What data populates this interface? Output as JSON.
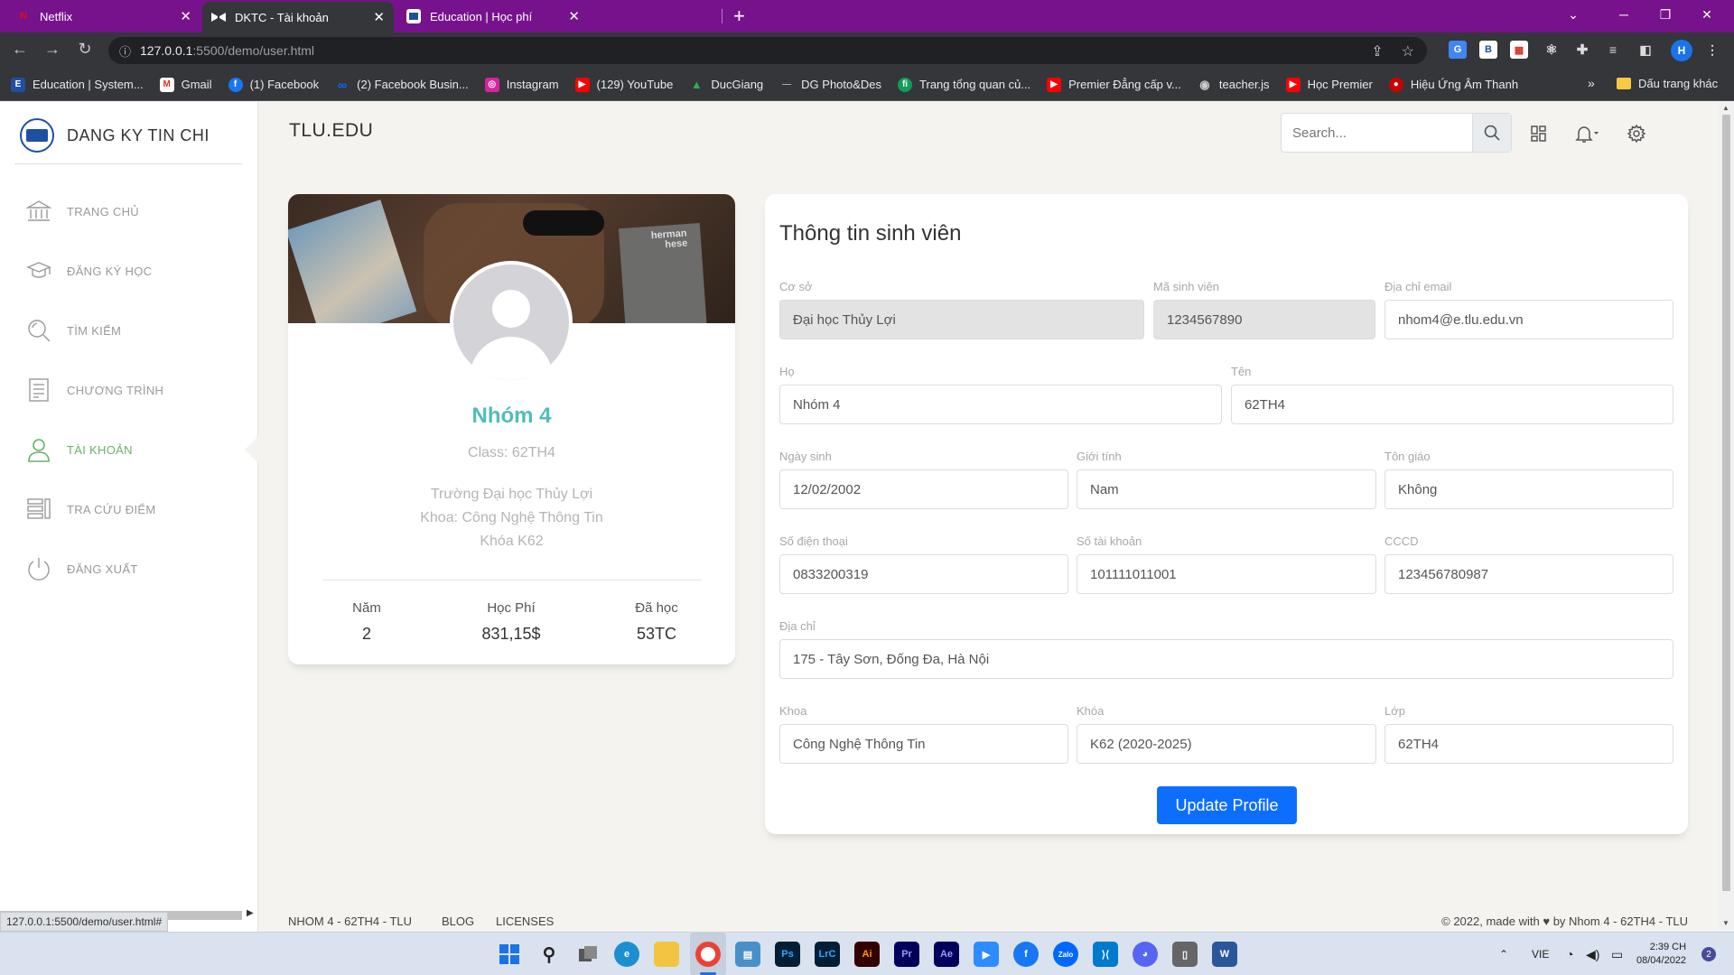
{
  "browser": {
    "tabs": [
      {
        "title": "Netflix",
        "icon": "netflix-icon",
        "color": "#e50914"
      },
      {
        "title": "DKTC - Tài khoản",
        "icon": "bow-tie-icon",
        "color": "#ffffff"
      },
      {
        "title": "Education | Học phí",
        "icon": "education-favicon",
        "color": "#1f4fa0"
      }
    ],
    "url_host": "127.0.0.1",
    "url_path": ":5500/demo/user.html",
    "profile_initial": "H",
    "bookmarks": [
      {
        "label": "Education | System...",
        "color": "#1f4fa0"
      },
      {
        "label": "Gmail",
        "color": "#d93025"
      },
      {
        "label": "(1) Facebook",
        "color": "#1877f2"
      },
      {
        "label": "(2) Facebook Busin...",
        "color": "#0866ff"
      },
      {
        "label": "Instagram",
        "color": "#d6249f"
      },
      {
        "label": "(129) YouTube",
        "color": "#ff0000"
      },
      {
        "label": "DucGiang",
        "color": "#34a853"
      },
      {
        "label": "DG Photo&Des",
        "color": "#555555"
      },
      {
        "label": "Trang tổng quan củ...",
        "color": "#0f9d58"
      },
      {
        "label": "Premier Đẳng cấp v...",
        "color": "#ff0000"
      },
      {
        "label": "teacher.js",
        "color": "#777777"
      },
      {
        "label": "Học Premier",
        "color": "#ff0000"
      },
      {
        "label": "Hiệu Ứng Âm Thanh",
        "color": "#cc0000"
      }
    ],
    "bookmarks_more": "»",
    "other_bookmarks": "Dấu trang khác",
    "status_url": "127.0.0.1:5500/demo/user.html#"
  },
  "sidebar": {
    "brand": "DANG KY TIN CHI",
    "items": [
      {
        "label": "TRANG CHỦ",
        "icon": "bank-icon",
        "active": false
      },
      {
        "label": "ĐĂNG KÝ HỌC",
        "icon": "graduation-cap-icon",
        "active": false
      },
      {
        "label": "TÌM KIẾM",
        "icon": "search-icon",
        "active": false
      },
      {
        "label": "CHƯƠNG TRÌNH",
        "icon": "document-icon",
        "active": false
      },
      {
        "label": "TÀI KHOẢN",
        "icon": "user-icon",
        "active": true
      },
      {
        "label": "TRA CỨU ĐIỂM",
        "icon": "list-icon",
        "active": false
      },
      {
        "label": "ĐĂNG XUẤT",
        "icon": "power-icon",
        "active": false
      }
    ]
  },
  "topbar": {
    "title": "TLU.EDU",
    "search_placeholder": "Search..."
  },
  "profile": {
    "name": "Nhóm 4",
    "class": "Class: 62TH4",
    "desc_line1": "Trường Đại học Thủy Lợi",
    "desc_line2": "Khoa: Công Nghệ Thông Tin",
    "desc_line3": "Khóa K62",
    "cover_book_text": "herman hese",
    "stats": [
      {
        "key": "Năm",
        "value": "2"
      },
      {
        "key": "Học Phí",
        "value": "831,15$"
      },
      {
        "key": "Đã học",
        "value": "53TC"
      }
    ]
  },
  "info": {
    "title": "Thông tin sinh viên",
    "fields": {
      "co_so": {
        "label": "Cơ sở",
        "value": "Đại học Thủy Lợi"
      },
      "ma_sv": {
        "label": "Mã sinh viên",
        "value": "1234567890"
      },
      "email": {
        "label": "Địa chỉ email",
        "value": "nhom4@e.tlu.edu.vn"
      },
      "ho": {
        "label": "Họ",
        "value": "Nhóm 4"
      },
      "ten": {
        "label": "Tên",
        "value": "62TH4"
      },
      "ngay_sinh": {
        "label": "Ngày sinh",
        "value": "12/02/2002"
      },
      "gioi_tinh": {
        "label": "Giới tính",
        "value": "Nam"
      },
      "ton_giao": {
        "label": "Tôn giáo",
        "value": "Không"
      },
      "sdt": {
        "label": "Số điện thoại",
        "value": "0833200319"
      },
      "stk": {
        "label": "Số tài khoản",
        "value": "101111011001"
      },
      "cccd": {
        "label": "CCCD",
        "value": "123456780987"
      },
      "dia_chi": {
        "label": "Địa chỉ",
        "value": "175 - Tây Sơn, Đống Đa, Hà Nội"
      },
      "khoa": {
        "label": "Khoa",
        "value": "Công Nghệ Thông Tin"
      },
      "khoa_hoc": {
        "label": "Khóa",
        "value": "K62 (2020-2025)"
      },
      "lop": {
        "label": "Lớp",
        "value": "62TH4"
      }
    },
    "update_button": "Update Profile"
  },
  "footer": {
    "links": [
      "NHOM 4 - 62TH4 - TLU",
      "BLOG",
      "LICENSES"
    ],
    "copy_prefix": "© 2022, made with",
    "copy_suffix": "by Nhom 4 - 62TH4 - TLU"
  },
  "taskbar": {
    "lang": "VIE",
    "time": "2:39 CH",
    "date": "08/04/2022",
    "notifications": "2"
  },
  "colors": {
    "tabbar": "#77128d",
    "accent_teal": "#51bcbc",
    "active_nav": "#6bb06b",
    "primary_button": "#0d6efd"
  }
}
